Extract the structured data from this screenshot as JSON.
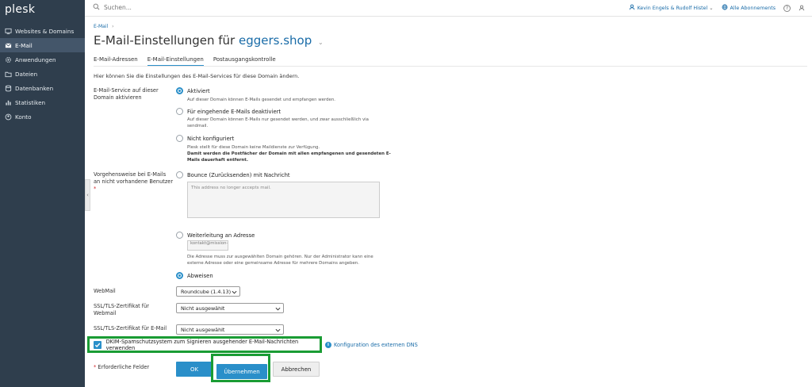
{
  "app": {
    "logo": "plesk"
  },
  "sidebar": {
    "items": [
      {
        "label": "Websites & Domains",
        "icon": "monitor-icon",
        "active": false
      },
      {
        "label": "E-Mail",
        "icon": "envelope-icon",
        "active": true
      },
      {
        "label": "Anwendungen",
        "icon": "gear-icon",
        "active": false
      },
      {
        "label": "Dateien",
        "icon": "folder-icon",
        "active": false
      },
      {
        "label": "Datenbanken",
        "icon": "database-icon",
        "active": false
      },
      {
        "label": "Statistiken",
        "icon": "bar-chart-icon",
        "active": false
      },
      {
        "label": "Konto",
        "icon": "user-circle-icon",
        "active": false
      }
    ],
    "collapse_glyph": "‹"
  },
  "topbar": {
    "search_placeholder": "Suchen...",
    "user": "Kevin Engels & Rudolf Histel",
    "subscriptions": "Alle Abonnements",
    "help_glyph": "?",
    "user_chevron": "⌄"
  },
  "page": {
    "breadcrumb": "E-Mail",
    "breadcrumb_sep": "›",
    "title_prefix": "E-Mail-Einstellungen für",
    "title_domain": "eggers.shop",
    "title_chevron": "⌄",
    "tabs": [
      {
        "label": "E-Mail-Adressen",
        "active": false
      },
      {
        "label": "E-Mail-Einstellungen",
        "active": true
      },
      {
        "label": "Postausgangskontrolle",
        "active": false
      }
    ],
    "intro": "Hier können Sie die Einstellungen des E-Mail-Services für diese Domain ändern."
  },
  "form": {
    "service_label_1": "E-Mail-Service auf dieser",
    "service_label_2": "Domain aktivieren",
    "service_options": [
      {
        "label": "Aktiviert",
        "checked": true,
        "hint": "Auf dieser Domain können E-Mails gesendet und empfangen werden."
      },
      {
        "label": "Für eingehende E-Mails deaktiviert",
        "checked": false,
        "hint_1": "Auf dieser Domain können E-Mails nur gesendet werden, und zwar ausschließlich via",
        "hint_2": "sendmail."
      },
      {
        "label": "Nicht konfiguriert",
        "checked": false,
        "hint_1": "Plesk stellt für diese Domain keine Maildienste zur Verfügung.",
        "hint_bold_1": "Damit werden die Postfächer der Domain mit allen empfangenen und gesendeten E-",
        "hint_bold_2": "Mails dauerhaft entfernt."
      }
    ],
    "nonexist_label_1": "Vorgehensweise bei E-Mails",
    "nonexist_label_2": "an nicht vorhandene Benutzer",
    "required_mark": "*",
    "bounce": {
      "label": "Bounce (Zurücksenden) mit Nachricht",
      "checked": false,
      "message": "This address no longer accepts mail."
    },
    "forward": {
      "label": "Weiterleitung an Adresse",
      "checked": false,
      "value": "kontakt@mission-webstyle",
      "hint_1": "Die Adresse muss zur ausgewählten Domain gehören. Nur der Administrator kann eine",
      "hint_2": "externe Adresse oder eine gemeinsame Adresse für mehrere Domains angeben."
    },
    "reject": {
      "label": "Abweisen",
      "checked": true
    },
    "webmail": {
      "label": "WebMail",
      "value": "Roundcube (1.4.13)"
    },
    "ssl_webmail": {
      "label_1": "SSL/TLS-Zertifikat für",
      "label_2": "Webmail",
      "value": "Nicht ausgewählt"
    },
    "ssl_email": {
      "label": "SSL/TLS-Zertifikat für E-Mail",
      "value": "Nicht ausgewählt"
    },
    "dkim": {
      "label": "DKIM-Spamschutzsystem zum Signieren ausgehender E-Mail-Nachrichten verwenden",
      "checked": true,
      "link": "Konfiguration des externen DNS",
      "info_glyph": "i"
    },
    "required_fields": "Erforderliche Felder"
  },
  "buttons": {
    "ok": "OK",
    "apply": "Übernehmen",
    "cancel": "Abbrechen"
  },
  "colors": {
    "sidebar_bg": "#2f3e4d",
    "accent": "#2a8fc9",
    "link": "#1a6ca8",
    "highlight": "#1a9c34"
  }
}
